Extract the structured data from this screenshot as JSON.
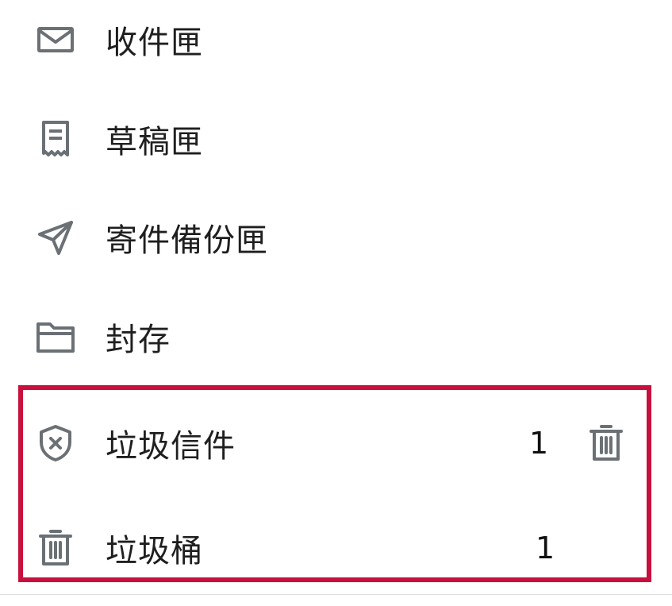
{
  "folders": [
    {
      "label": "收件匣",
      "icon": "inbox-icon"
    },
    {
      "label": "草稿匣",
      "icon": "drafts-icon"
    },
    {
      "label": "寄件備份匣",
      "icon": "sent-icon"
    },
    {
      "label": "封存",
      "icon": "archive-folder-icon"
    },
    {
      "label": "垃圾信件",
      "icon": "spam-shield-icon",
      "count": "1",
      "action_icon": "empty-spam-trash-icon"
    },
    {
      "label": "垃圾桶",
      "icon": "trash-icon",
      "count": "1"
    }
  ],
  "colors": {
    "icon": "#6b7075",
    "text": "#1f1f1f",
    "highlight_border": "#c8103e"
  }
}
